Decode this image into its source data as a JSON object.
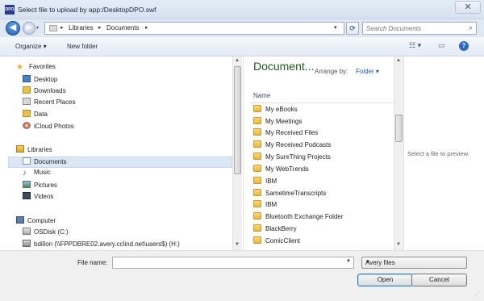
{
  "window": {
    "title": "Select file to upload by app:/DesktopDPO.swf",
    "close_glyph": "✕",
    "app_icon_text": "DPO"
  },
  "address_bar": {
    "crumbs": [
      "Libraries",
      "Documents"
    ],
    "search_placeholder": "Search Documents"
  },
  "toolbar": {
    "organize_label": "Organize ▾",
    "new_folder_label": "New folder"
  },
  "nav": {
    "favorites_header": "Favorites",
    "favorites": [
      "Desktop",
      "Downloads",
      "Recent Places",
      "Data",
      "iCloud Photos"
    ],
    "libraries_header": "Libraries",
    "libraries": [
      "Documents",
      "Music",
      "Pictures",
      "Videos"
    ],
    "computer_header": "Computer",
    "computer": [
      "OSDisk (C:)",
      "bdillon (\\\\FPPDBRE02.avery.cclind.net\\users$) (H:)"
    ],
    "selected": "Documents"
  },
  "file_list": {
    "library_title": "Document...",
    "arrange_label": "Arrange by:",
    "arrange_value": "Folder",
    "column_name": "Name",
    "items": [
      "My eBooks",
      "My Meetings",
      "My Received Files",
      "My Received Podcasts",
      "My SureThing Projects",
      "My WebTrends",
      "IBM",
      "SametimeTranscripts",
      "IBM",
      "Bluetooth Exchange Folder",
      "BlackBerry",
      "ComicClient"
    ]
  },
  "preview": {
    "message": "Select a file to preview."
  },
  "footer": {
    "file_name_label": "File name:",
    "file_name_value": "",
    "file_type": "Avery files",
    "open_label": "Open",
    "cancel_label": "Cancel"
  },
  "colors": {
    "library_title": "#1e5c1e",
    "accent": "#1d5ba9",
    "selection": "#dce7f5"
  }
}
